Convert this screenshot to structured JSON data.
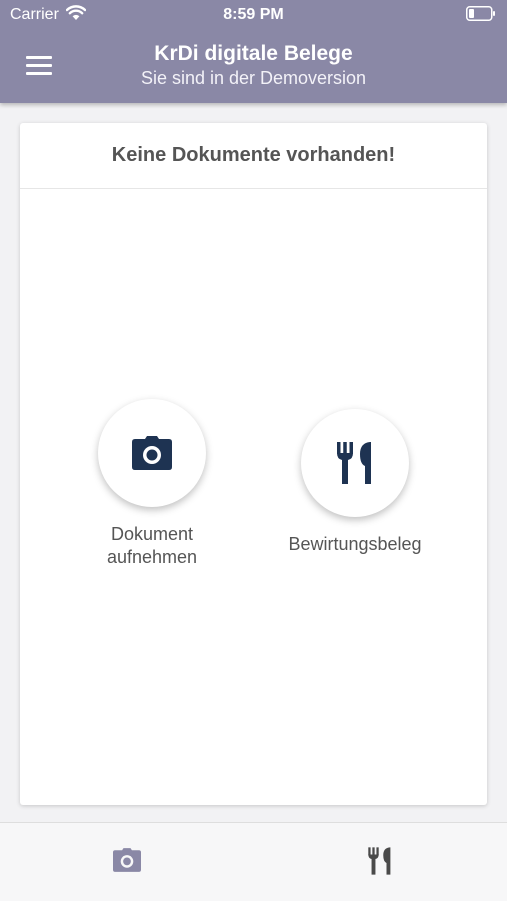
{
  "status_bar": {
    "carrier": "Carrier",
    "time": "8:59 PM"
  },
  "app_bar": {
    "title": "KrDi digitale Belege",
    "subtitle": "Sie sind in der Demoversion"
  },
  "card": {
    "message": "Keine Dokumente vorhanden!",
    "actions": [
      {
        "label_line1": "Dokument",
        "label_line2": "aufnehmen",
        "icon": "camera-icon"
      },
      {
        "label": "Bewirtungsbeleg",
        "icon": "cutlery-icon"
      }
    ]
  },
  "bottom_nav": {
    "tabs": [
      {
        "icon": "camera-icon"
      },
      {
        "icon": "cutlery-icon"
      }
    ]
  },
  "colors": {
    "app_bar": "#8a88a6",
    "icon_dark": "#1e3352",
    "tab_camera": "#8a88a6",
    "tab_cutlery": "#4a4a4a"
  }
}
